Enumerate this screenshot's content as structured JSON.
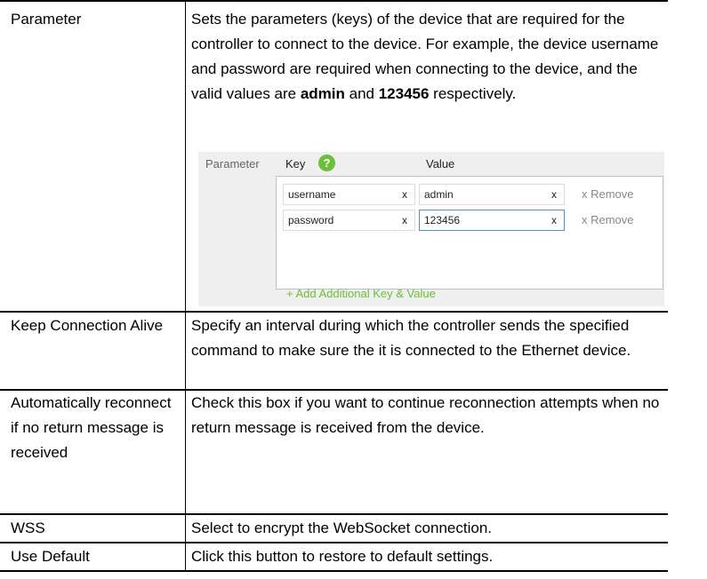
{
  "rows": [
    {
      "name": "Parameter",
      "desc_parts": [
        "Sets the parameters (keys) of the device that are required for the controller to connect to the device. For example, the device username and password are required when connecting to the device, and the valid values are ",
        "admin",
        " and ",
        "123456",
        " respectively."
      ]
    },
    {
      "name": "Keep Connection Alive",
      "desc": "Specify an interval during which the controller sends the specified command to make sure the it is connected to the Ethernet device."
    },
    {
      "name": "Automatically reconnect if no return message is received",
      "desc": "Check this box if you want to continue reconnection attempts when no return message is received from the device."
    },
    {
      "name": "WSS",
      "desc": "Select to encrypt the WebSocket connection."
    },
    {
      "name": "Use Default",
      "desc": "Click this button to restore to default settings."
    }
  ],
  "panel": {
    "label": "Parameter",
    "key_header": "Key",
    "help_glyph": "?",
    "value_header": "Value",
    "pairs": [
      {
        "key": "username",
        "value": "admin",
        "clear": "x",
        "remove": "x Remove"
      },
      {
        "key": "password",
        "value": "123456",
        "clear": "x",
        "remove": "x Remove"
      }
    ],
    "add_link": "+ Add Additional Key & Value",
    "accent_color": "#6cbf3a"
  }
}
